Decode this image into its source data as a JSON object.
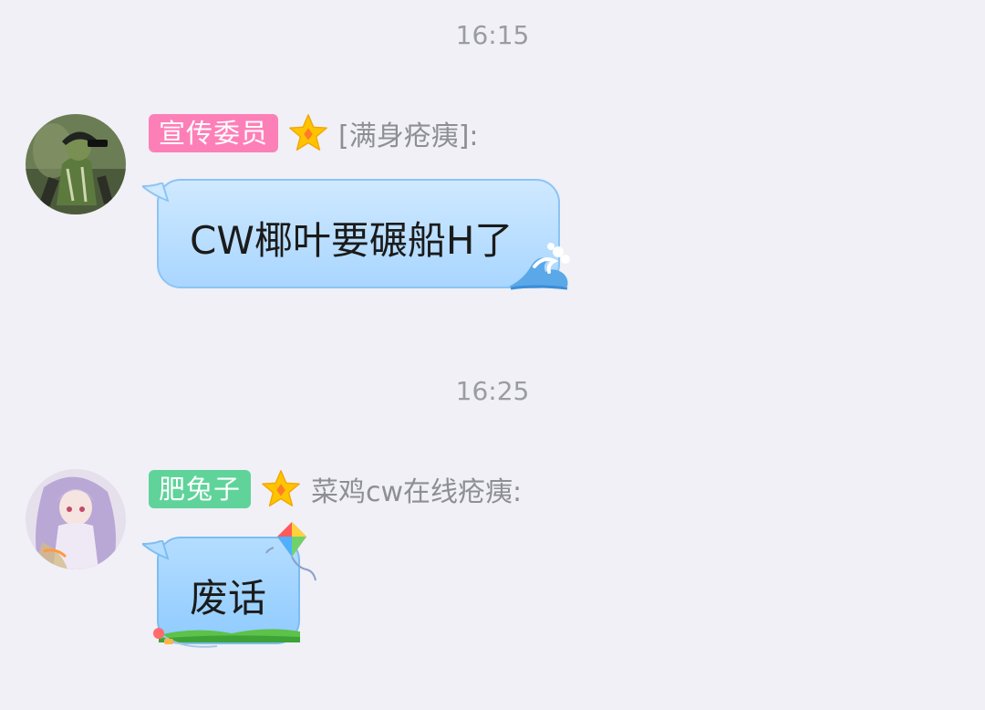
{
  "messages": [
    {
      "time": "16:15",
      "tag": "宣传委员",
      "tag_color": "#fd7fb8",
      "sender": "[满身疮痍]:",
      "text": "CW椰叶要碾船H了",
      "avatar": "avatar-green-figure",
      "bubble_decor": "wave-icon"
    },
    {
      "time": "16:25",
      "tag": "肥兔子",
      "tag_color": "#5fd39a",
      "sender": "菜鸡cw在线疮痍:",
      "text": "废话",
      "avatar": "avatar-anime-girl",
      "bubble_decor": "kite-icon"
    }
  ],
  "colors": {
    "background": "#f0f0f6",
    "timestamp": "#9b9ba3",
    "nickname": "#8e8e96",
    "star": "#ffc400"
  }
}
